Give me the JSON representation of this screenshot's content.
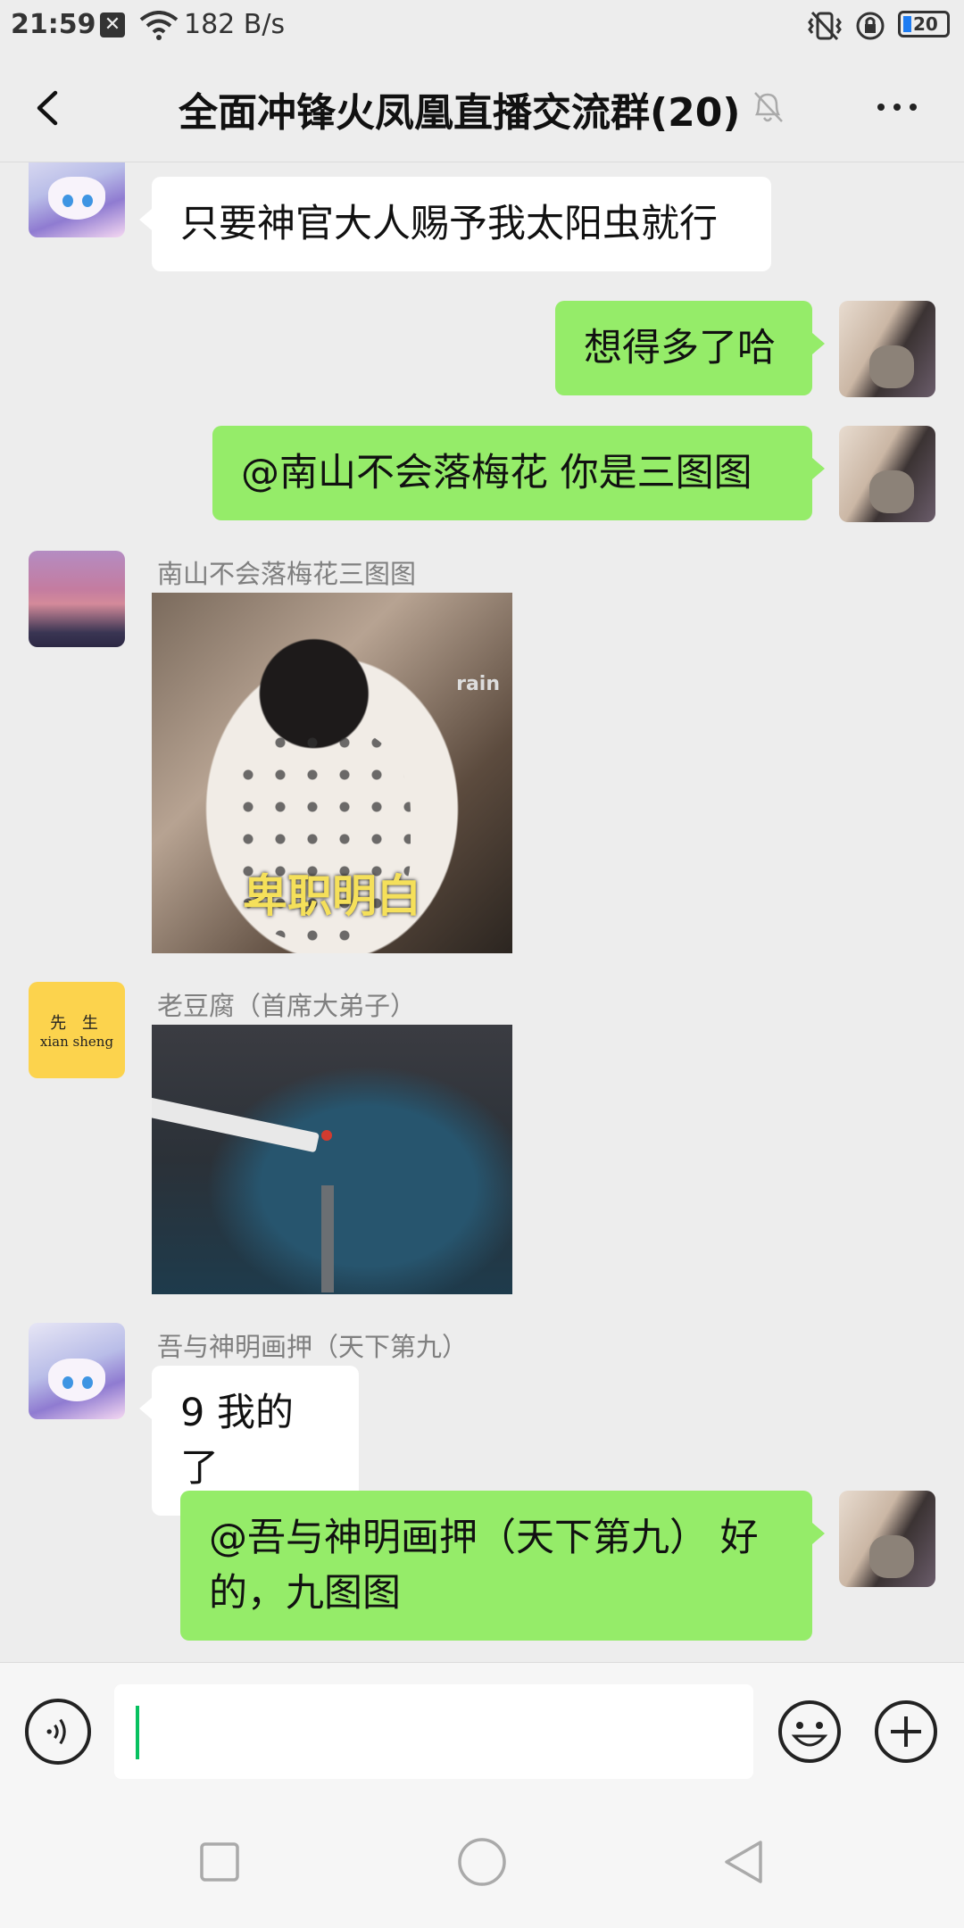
{
  "status_bar": {
    "time": "21:59",
    "sim_icon_glyph": "✕",
    "net_speed": "182 B/s",
    "battery_level": "20",
    "battery_fraction": 0.2
  },
  "header": {
    "title": "全面冲锋火凤凰直播交流群(20)"
  },
  "messages": [
    {
      "side": "left",
      "type": "text",
      "avatar": "anime-girl",
      "text": "只要神官大人赐予我太阳虫就行"
    },
    {
      "side": "right",
      "type": "text",
      "avatar": "self-girl",
      "text": "想得多了哈"
    },
    {
      "side": "right",
      "type": "text",
      "avatar": "self-girl",
      "text": "@南山不会落梅花  你是三图图"
    },
    {
      "side": "left",
      "type": "image",
      "avatar": "sunset",
      "sender": "南山不会落梅花三图图",
      "image_watermark": "rain",
      "image_caption": "卑职明白"
    },
    {
      "side": "left",
      "type": "image",
      "avatar": "xiansheng",
      "sender": "老豆腐（首席大弟子）",
      "avatar_text": [
        "先 生",
        "xian sheng"
      ]
    },
    {
      "side": "left",
      "type": "text",
      "avatar": "anime-girl",
      "sender": "吾与神明画押（天下第九）",
      "text": "9 我的了"
    },
    {
      "side": "right",
      "type": "text",
      "avatar": "self-girl",
      "text": "@吾与神明画押（天下第九） 好的，九图图"
    }
  ],
  "input": {
    "value": ""
  },
  "icons": {
    "back": "chevron-left-icon",
    "mute": "bell-off-icon",
    "more": "more-horizontal-icon",
    "voice": "voice-icon",
    "emoji": "emoji-icon",
    "plus": "plus-circle-icon",
    "nav_recent": "square-icon",
    "nav_home": "circle-icon",
    "nav_back": "triangle-back-icon"
  },
  "colors": {
    "background": "#ededed",
    "bubble_self": "#95ec69",
    "bubble_other": "#ffffff",
    "caret": "#07c160"
  }
}
